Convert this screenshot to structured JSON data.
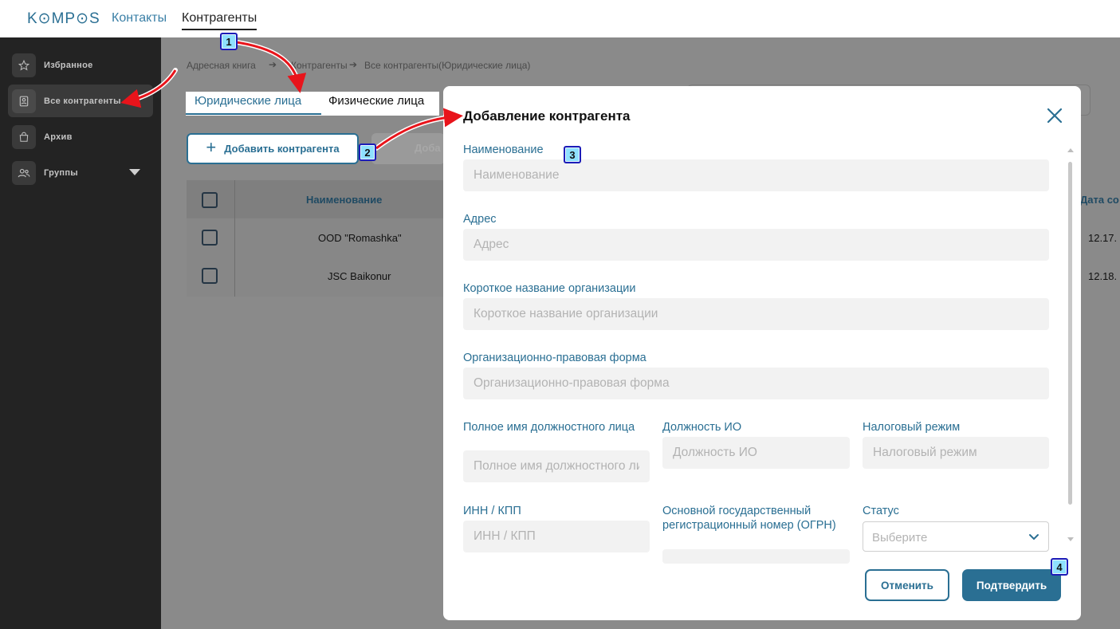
{
  "header": {
    "logo": "K⊙MP⊙S",
    "nav": [
      {
        "label": "Контакты",
        "active": false
      },
      {
        "label": "Контрагенты",
        "active": true
      }
    ]
  },
  "sidebar": {
    "items": [
      {
        "label": "Избранное",
        "icon": "star-icon",
        "active": false
      },
      {
        "label": "Все контрагенты",
        "icon": "contact-card-icon",
        "active": true
      },
      {
        "label": "Архив",
        "icon": "archive-bag-icon",
        "active": false
      },
      {
        "label": "Группы",
        "icon": "users-icon",
        "active": false,
        "expandable": true
      }
    ]
  },
  "main": {
    "breadcrumb": [
      "Адресная книга",
      "Контрагенты",
      "Все контрагенты(Юридические лица)"
    ],
    "tabs": [
      {
        "label": "Юридические лица",
        "active": true
      },
      {
        "label": "Физические лица",
        "active": false
      }
    ],
    "add_button": "Добавить контрагента",
    "second_button_partial": "Доба",
    "table": {
      "columns": [
        "Наименование",
        "Дата со"
      ],
      "rows": [
        {
          "name": "OOD \"Romashka\"",
          "date": "12.17."
        },
        {
          "name": "JSC Baikonur",
          "date": "12.18."
        }
      ]
    }
  },
  "modal": {
    "title": "Добавление контрагента",
    "fields": {
      "name": {
        "label": "Наименование",
        "placeholder": "Наименование"
      },
      "address": {
        "label": "Адрес",
        "placeholder": "Адрес"
      },
      "short_name": {
        "label": "Короткое название организации",
        "placeholder": "Короткое название организации"
      },
      "legal_form": {
        "label": "Организационно-правовая форма",
        "placeholder": "Организационно-правовая форма"
      },
      "official_name": {
        "label": "Полное имя должностного лица",
        "placeholder": "Полное имя должностного лица"
      },
      "position": {
        "label": "Должность ИО",
        "placeholder": "Должность ИО"
      },
      "tax_mode": {
        "label": "Налоговый режим",
        "placeholder": "Налоговый режим"
      },
      "inn_kpp": {
        "label": "ИНН / КПП",
        "placeholder": "ИНН / КПП"
      },
      "ogrn": {
        "label": "Основной государственный регистрационный номер (ОГРН)"
      },
      "status": {
        "label": "Статус",
        "placeholder": "Выберите"
      }
    },
    "cancel_label": "Отменить",
    "confirm_label": "Подтвердить"
  },
  "annotations": {
    "badges": [
      "1",
      "2",
      "3",
      "4"
    ],
    "arrow_color": "#e8141b",
    "badge_color": "#8fe0ff"
  },
  "colors": {
    "accent": "#2a6f93",
    "sidebar_bg": "#232323",
    "overlay_bg": "#8a8a8a"
  }
}
